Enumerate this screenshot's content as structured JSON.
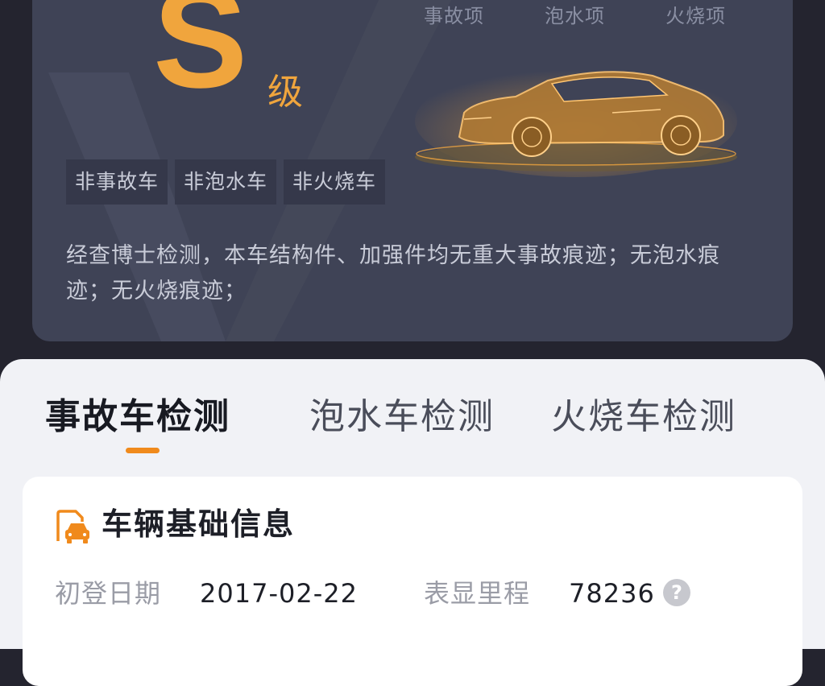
{
  "report": {
    "categories": [
      "事故项",
      "泡水项",
      "火烧项"
    ],
    "grade": "S",
    "grade_suffix": "级",
    "tags": [
      "非事故车",
      "非泡水车",
      "非火烧车"
    ],
    "description": "经查博士检测，本车结构件、加强件均无重大事故痕迹；无泡水痕迹；无火烧痕迹；"
  },
  "tabs": [
    {
      "label": "事故车检测",
      "active": true
    },
    {
      "label": "泡水车检测",
      "active": false
    },
    {
      "label": "火烧车检测",
      "active": false
    }
  ],
  "basic_info": {
    "title": "车辆基础信息",
    "first_registration_label": "初登日期",
    "first_registration_value": "2017-02-22",
    "mileage_label": "表显里程",
    "mileage_value": "78236"
  },
  "colors": {
    "accent": "#f0a53d",
    "tab_indicator": "#f08a1c",
    "dark_card": "#3f4356",
    "sheet_bg": "#f1f2f6"
  },
  "icons": {
    "car_doc": "car-document-icon",
    "help": "question-circle-icon"
  }
}
